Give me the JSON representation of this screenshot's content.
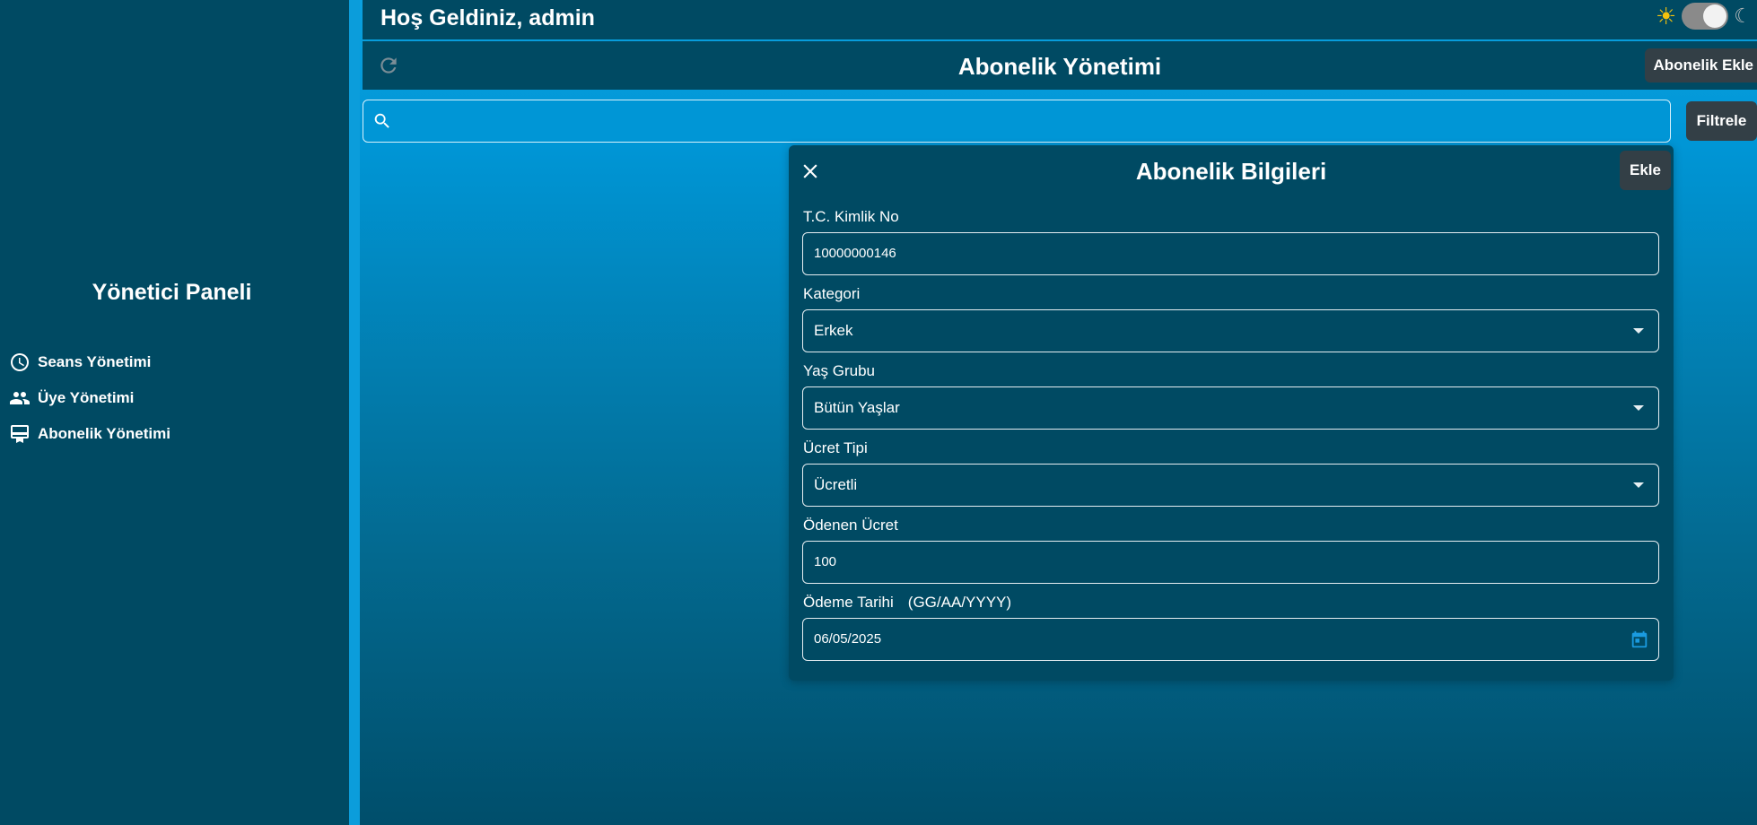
{
  "sidebar": {
    "title": "Yönetici Paneli",
    "items": [
      {
        "label": "Seans Yönetimi",
        "icon": "clock-icon"
      },
      {
        "label": "Üye Yönetimi",
        "icon": "people-icon"
      },
      {
        "label": "Abonelik Yönetimi",
        "icon": "card-membership-icon"
      }
    ]
  },
  "header": {
    "welcome": "Hoş Geldiniz, admin",
    "page_title": "Abonelik Yönetimi",
    "add_button": "Abonelik Ekle",
    "theme": "light"
  },
  "search": {
    "placeholder": "",
    "value": "",
    "filter_button": "Filtrele"
  },
  "modal": {
    "title": "Abonelik Bilgileri",
    "add_button": "Ekle",
    "fields": {
      "tc": {
        "label": "T.C. Kimlik No",
        "value": "10000000146"
      },
      "kategori": {
        "label": "Kategori",
        "value": "Erkek"
      },
      "yas_grubu": {
        "label": "Yaş Grubu",
        "value": "Bütün Yaşlar"
      },
      "ucret_tipi": {
        "label": "Ücret Tipi",
        "value": "Ücretli"
      },
      "odenen_ucret": {
        "label": "Ödenen Ücret",
        "value": "100"
      },
      "odeme_tarihi": {
        "label": "Ödeme Tarihi",
        "hint": "(GG/AA/YYYY)",
        "value": "06/05/2025"
      }
    }
  },
  "colors": {
    "panel": "#004a63",
    "accent": "#0096d6",
    "button": "#333f46",
    "sun": "#f4c20d"
  }
}
